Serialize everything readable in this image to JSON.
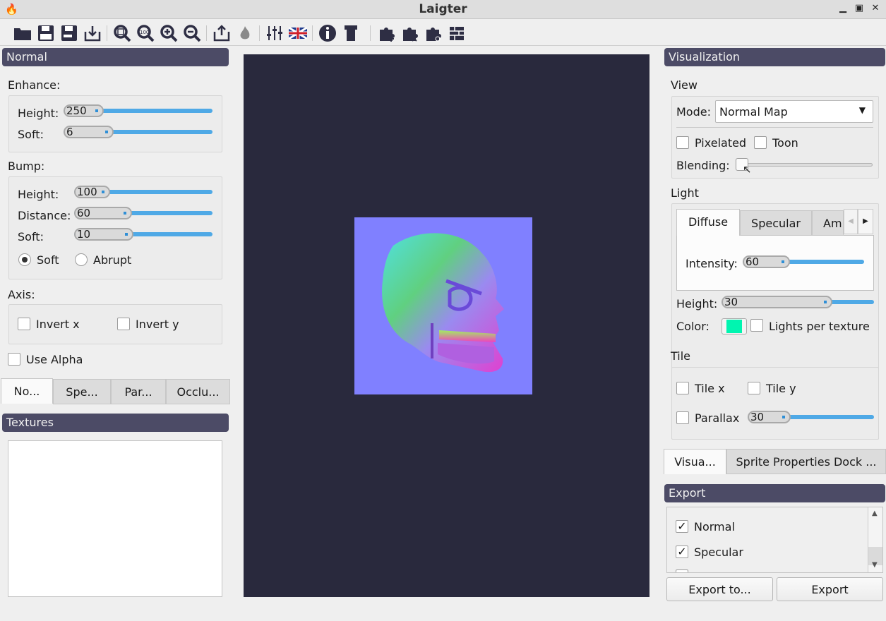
{
  "window": {
    "title": "Laigter",
    "controls": [
      "minimize",
      "maximize",
      "close"
    ]
  },
  "toolbar": {
    "icons": [
      "open-folder-icon",
      "save-icon",
      "save-as-icon",
      "import-icon",
      "zoom-fit-icon",
      "zoom-100-icon",
      "zoom-in-icon",
      "zoom-out-icon",
      "export-icon",
      "add-plugin-fire-icon",
      "presets-sliders-icon",
      "language-flag-icon",
      "info-icon",
      "shirt-icon",
      "add-light-icon",
      "remove-light-icon",
      "light-settings-icon",
      "tileset-icon"
    ]
  },
  "normal_dock": {
    "title": "Normal",
    "enhance": {
      "label": "Enhance:",
      "height_label": "Height:",
      "height": "250",
      "soft_label": "Soft:",
      "soft": "6"
    },
    "bump": {
      "label": "Bump:",
      "height_label": "Height:",
      "height": "100",
      "distance_label": "Distance:",
      "distance": "60",
      "soft_label": "Soft:",
      "soft": "10",
      "mode_soft": "Soft",
      "mode_abrupt": "Abrupt",
      "selected": "Soft"
    },
    "axis": {
      "label": "Axis:",
      "invert_x": "Invert x",
      "invert_y": "Invert y"
    },
    "use_alpha": "Use Alpha",
    "tabs": [
      "No...",
      "Spe...",
      "Par...",
      "Occlu..."
    ]
  },
  "textures_dock": {
    "title": "Textures"
  },
  "visualization": {
    "title": "Visualization",
    "view": {
      "label": "View",
      "mode_label": "Mode:",
      "mode": "Normal Map",
      "pixelated": "Pixelated",
      "toon": "Toon",
      "blending_label": "Blending:",
      "blending": 0
    },
    "light": {
      "label": "Light",
      "tabs": [
        "Diffuse",
        "Specular",
        "Am"
      ],
      "intensity_label": "Intensity:",
      "intensity": "60",
      "height_label": "Height:",
      "height": "30",
      "color_label": "Color:",
      "color": "#00f5b0",
      "lights_per_texture": "Lights per texture"
    },
    "tile": {
      "label": "Tile",
      "tile_x": "Tile x",
      "tile_y": "Tile y",
      "parallax": "Parallax",
      "parallax_value": "30"
    },
    "tabs": [
      "Visua...",
      "Sprite Properties Dock ..."
    ]
  },
  "export": {
    "title": "Export",
    "items": [
      {
        "label": "Normal",
        "checked": true
      },
      {
        "label": "Specular",
        "checked": true
      }
    ],
    "export_to": "Export to...",
    "export": "Export"
  },
  "colors": {
    "canvas_bg": "#29293d",
    "dock_header": "#4c4b66",
    "slider": "#4fa9e6",
    "sprite_bg": "#8080ff"
  }
}
